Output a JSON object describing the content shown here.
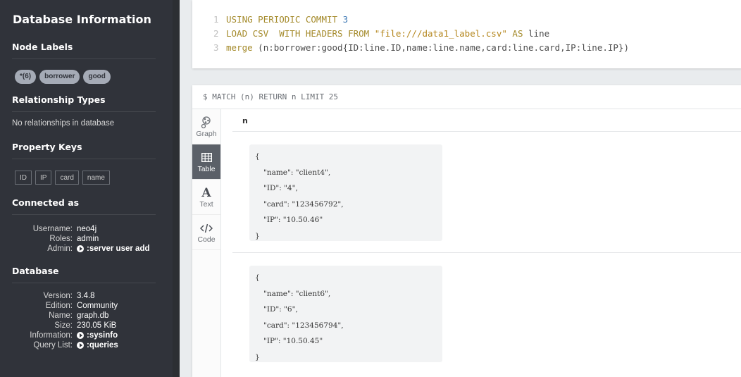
{
  "sidebar": {
    "title": "Database Information",
    "node_labels": {
      "heading": "Node Labels",
      "pills": [
        "*(6)",
        "borrower",
        "good"
      ]
    },
    "relationship_types": {
      "heading": "Relationship Types",
      "empty_text": "No relationships in database"
    },
    "property_keys": {
      "heading": "Property Keys",
      "keys": [
        "ID",
        "IP",
        "card",
        "name"
      ]
    },
    "connected_as": {
      "heading": "Connected as",
      "username_label": "Username:",
      "username": "neo4j",
      "roles_label": "Roles:",
      "roles": "admin",
      "admin_label": "Admin:",
      "admin_cmd": ":server user add"
    },
    "database": {
      "heading": "Database",
      "version_label": "Version:",
      "version": "3.4.8",
      "edition_label": "Edition:",
      "edition": "Community",
      "name_label": "Name:",
      "name": "graph.db",
      "size_label": "Size:",
      "size": "230.05 KiB",
      "information_label": "Information:",
      "information_cmd": ":sysinfo",
      "querylist_label": "Query List:",
      "querylist_cmd": ":queries"
    }
  },
  "editor": {
    "line1": {
      "num": "1",
      "kw": "USING PERIODIC COMMIT",
      "value": "3"
    },
    "line2": {
      "num": "2",
      "kw1": "LOAD CSV  WITH HEADERS FROM",
      "str": "\"file:///data1_label.csv\"",
      "kw2": "AS",
      "rest": "line"
    },
    "line3": {
      "num": "3",
      "kw": "merge",
      "rest": "(n:borrower:good{ID:line.ID,name:line.name,card:line.card,IP:line.IP})"
    }
  },
  "result": {
    "query": "$ MATCH (n) RETURN n LIMIT 25",
    "column": "n",
    "tabs": {
      "graph": "Graph",
      "table": "Table",
      "text": "Text",
      "code": "Code"
    },
    "rows": [
      {
        "open": "{",
        "name": "\"name\": \"client4\",",
        "id": "\"ID\": \"4\",",
        "card": "\"card\": \"123456792\",",
        "ip": "\"IP\": \"10.50.46\"",
        "close": "}"
      },
      {
        "open": "{",
        "name": "\"name\": \"client6\",",
        "id": "\"ID\": \"6\",",
        "card": "\"card\": \"123456794\",",
        "ip": "\"IP\": \"10.50.45\"",
        "close": "}"
      }
    ]
  }
}
